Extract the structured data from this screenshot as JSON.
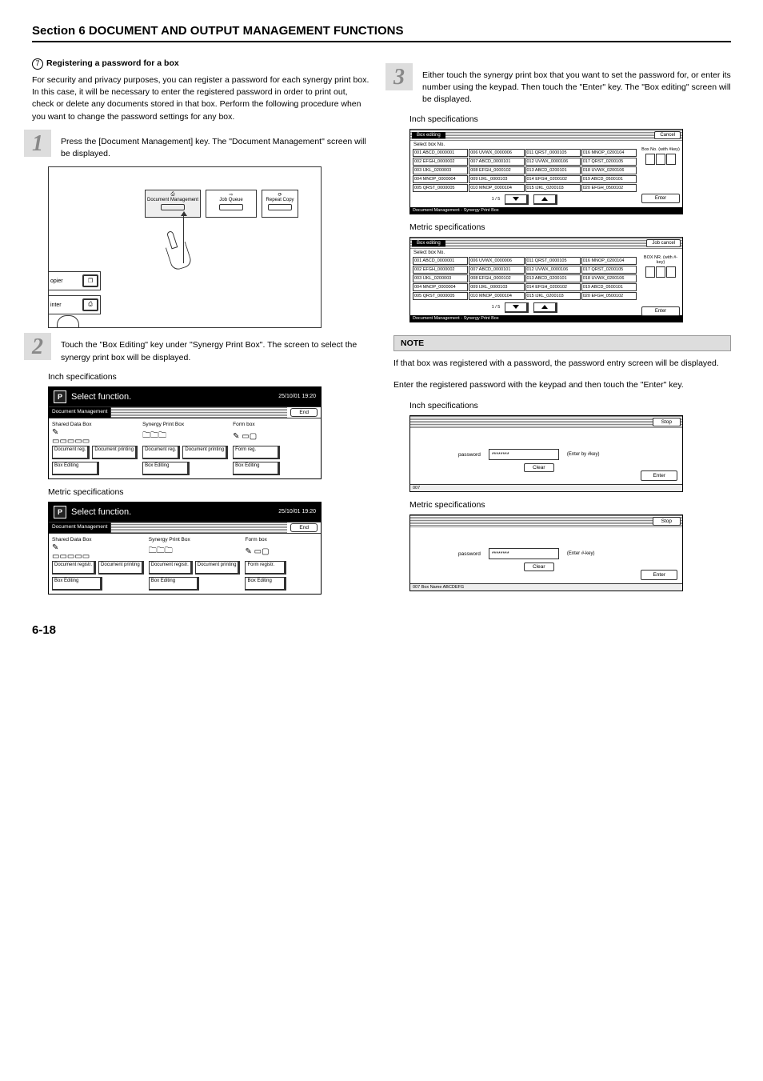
{
  "section_title": "Section 6  DOCUMENT AND OUTPUT MANAGEMENT FUNCTIONS",
  "heading": {
    "num": "7",
    "text": "Registering a password for a box"
  },
  "intro": "For security and privacy purposes, you can register a password for each synergy print box. In this case, it will be necessary to enter the registered password in order to print out, check or delete any documents stored in that box. Perform the following procedure when you want to change the password settings for any box.",
  "step1": "Press the [Document Management] key. The \"Document Management\" screen will be displayed.",
  "panel": {
    "doc_mgmt": "Document Management",
    "job_queue": "Job Queue",
    "repeat": "Repeat Copy",
    "side1": "opier",
    "side2": "inter"
  },
  "step2": "Touch the \"Box Editing\" key under \"Synergy Print Box\". The screen to select the synergy print box will be displayed.",
  "inch_spec": "Inch specifications",
  "metric_spec": "Metric specifications",
  "select_func": {
    "title": "Select function.",
    "date": "25/10/01 19:20",
    "bar": "Document Management",
    "end": "End",
    "col1": "Shared Data Box",
    "col2": "Synergy Print Box",
    "col3": "Form box",
    "inch_doc_reg": "Document reg.",
    "inch_doc_print": "Document printing",
    "metric_doc_reg": "Document registr.",
    "metric_doc_print": "Document printing",
    "form_reg_inch": "Form reg.",
    "form_reg_metric": "Form registr.",
    "box_edit": "Box Editing"
  },
  "step3": "Either touch the synergy print box that you want to set the password for, or enter its number using the keypad. Then touch the \"Enter\" key. The \"Box editing\" screen will be displayed.",
  "box_edit": {
    "title": "Box editing",
    "cancel": "Cancel",
    "job_cancel": "Job cancel",
    "select": "Select box No.",
    "boxno_inch": "Box No. (with #key)",
    "boxno_metric": "BOX NR. (with #-key)",
    "page": "1 / 5",
    "enter": "Enter",
    "footer": "Document Management - Synergy Print Box",
    "cells": [
      "001 ABCD_0000001",
      "006 UVWX_0000006",
      "011 QRST_0000105",
      "016 MNOP_0200104",
      "002 EFGH_0000002",
      "007  ABCD_0000101",
      "012 UVWX_0000106",
      "017 QRST_0200105",
      "003    IJKL_0200003",
      "008 EFGH_0000102",
      "013 ABCD_0200101",
      "018 UVWX_0200106",
      "004 MNOP_0000004",
      "009    IJKL_0000103",
      "014 EFGH_0200102",
      "019 ABCD_0500101",
      "005 QRST_0000005",
      "010 MNOP_0000104",
      "015    IJKL_0200103",
      "020 EFGH_0500102"
    ]
  },
  "note_label": "NOTE",
  "note_text1": "If that box was registered with a password, the password entry screen will be displayed.",
  "note_text2": "Enter the registered password with the keypad and then touch the \"Enter\" key.",
  "pw": {
    "stop": "Stop",
    "label": "password",
    "value": "********",
    "hint_inch": "(Enter by #key)",
    "hint_metric": "(Enter #-key)",
    "clear": "Clear",
    "enter": "Enter",
    "foot_inch": "007",
    "foot_metric": "007   Box Name ABCDEFG"
  },
  "page_num": "6-18"
}
